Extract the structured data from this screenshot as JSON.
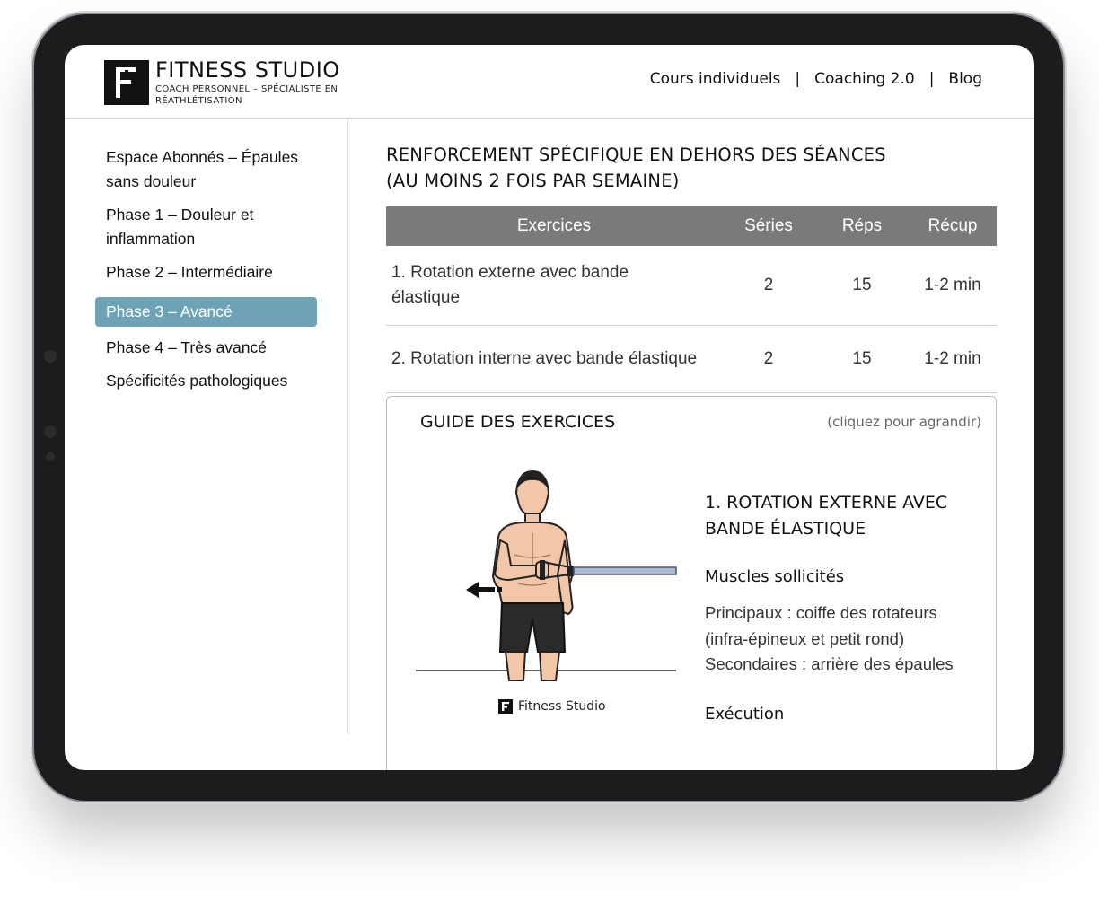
{
  "brand": {
    "title": "FITNESS STUDIO",
    "subtitle": "COACH PERSONNEL – SPÉCIALISTE EN RÉATHLÉTISATION"
  },
  "nav": {
    "items": [
      "Cours individuels",
      "Coaching 2.0",
      "Blog"
    ],
    "separator": "|"
  },
  "sidebar": {
    "items": [
      {
        "label": "Espace Abonnés – Épaules sans douleur"
      },
      {
        "label": "Phase 1 – Douleur et inflammation"
      },
      {
        "label": "Phase 2 – Intermédiaire"
      },
      {
        "label": "Phase 3 – Avancé",
        "active": true
      },
      {
        "label": "Phase 4 – Très avancé"
      },
      {
        "label": "Spécificités pathologiques"
      }
    ],
    "active_color": "#6ea3b7"
  },
  "section": {
    "title_line1": "RENFORCEMENT SPÉCIFIQUE EN DEHORS DES SÉANCES",
    "title_line2": "(AU MOINS 2 FOIS PAR SEMAINE)"
  },
  "table": {
    "headers": [
      "Exercices",
      "Séries",
      "Réps",
      "Récup"
    ],
    "rows": [
      [
        "1. Rotation externe avec bande élastique",
        "2",
        "15",
        "1-2 min"
      ],
      [
        "2. Rotation interne avec bande élastique",
        "2",
        "15",
        "1-2 min"
      ]
    ],
    "header_color": "#7a7a7a"
  },
  "guide": {
    "title": "GUIDE DES EXERCICES",
    "hint": "(cliquez pour agrandir)",
    "figure_brand": "Fitness Studio",
    "exercise_title": "1. ROTATION EXTERNE AVEC BANDE ÉLASTIQUE",
    "muscles_heading": "Muscles sollicités",
    "muscles_text_1": "Principaux : coiffe des rotateurs (infra-épineux et petit rond)",
    "muscles_text_2": "Secondaires : arrière des épaules",
    "execution_heading": "Exécution"
  }
}
